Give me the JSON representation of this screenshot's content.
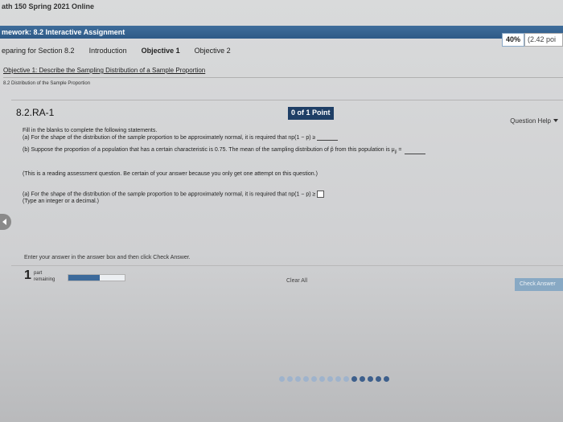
{
  "course_title": "ath 150 Spring 2021 Online",
  "homework": {
    "title": "mework: 8.2 Interactive Assignment",
    "score_pct": "40%",
    "points": "(2.42 poi"
  },
  "tabs": [
    {
      "label": "eparing for Section 8.2"
    },
    {
      "label": "Introduction"
    },
    {
      "label": "Objective 1"
    },
    {
      "label": "Objective 2"
    }
  ],
  "objective_link": "Objective 1: Describe the Sampling Distribution of a Sample Proportion",
  "sub_link": "8.2 Distribution of the Sample Proportion",
  "question": {
    "id": "8.2.RA-1",
    "points": "0 of 1 Point",
    "help_label": "Question Help",
    "intro": "Fill in the blanks to complete the following statements.",
    "part_a": "(a) For the shape of the distribution of the sample proportion to be approximately normal, it is required that np(1 − p) ≥",
    "part_b": "(b) Suppose the proportion of a population that has a certain characteristic is 0.75. The mean of the sampling distribution of p̂ from this population is μ",
    "part_b_sub": "p̂",
    "part_b_eq": " = ",
    "reading_note": "(This is a reading assessment question. Be certain of your answer because you only get one attempt on this question.)",
    "active_part_a": "(a) For the shape of the distribution of the sample proportion to be approximately normal, it is required that np(1 − p) ≥",
    "type_hint": "(Type an integer or a decimal.)"
  },
  "instruction": "Enter your answer in the answer box and then click Check Answer.",
  "parts": {
    "count": "1",
    "label_line1": "part",
    "label_line2": "remaining",
    "progress_fraction": 0.55
  },
  "clear_all_label": "Clear All",
  "check_answer_label": "Check Answer",
  "accent_color": "#2e5a87"
}
